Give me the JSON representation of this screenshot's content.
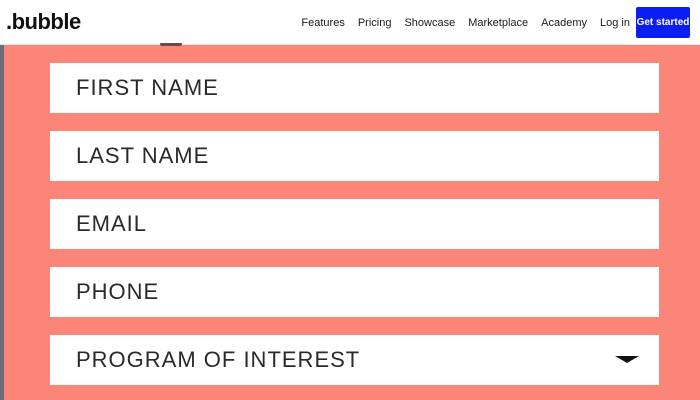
{
  "nav": {
    "logo": ".bubble",
    "links": [
      "Features",
      "Pricing",
      "Showcase",
      "Marketplace",
      "Academy",
      "Log in"
    ],
    "cta": "Get started",
    "cta_color": "#0b1df0"
  },
  "form": {
    "background": "#fc8579",
    "fields": {
      "first_name": "FIRST NAME",
      "last_name": "LAST NAME",
      "email": "EMAIL",
      "phone": "PHONE",
      "program": "PROGRAM OF INTEREST"
    },
    "program_icon": "caret-down-icon"
  }
}
